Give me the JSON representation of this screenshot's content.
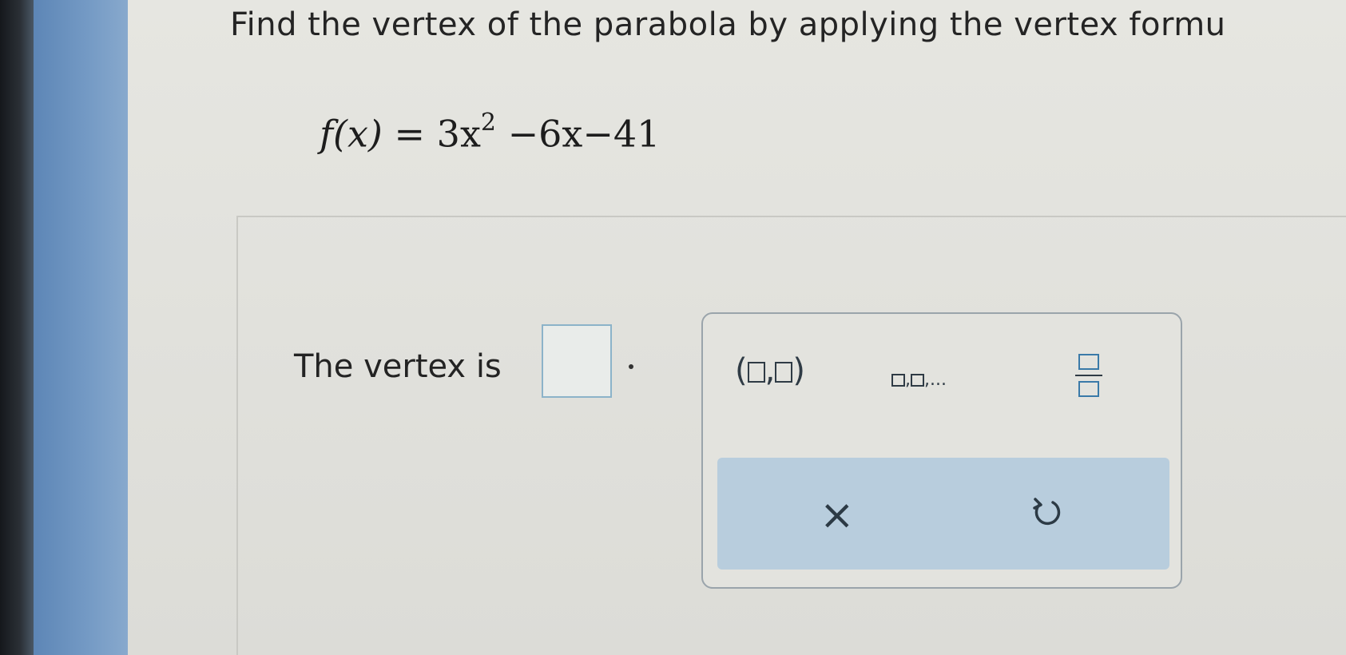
{
  "question": {
    "prompt": "Find the vertex of the parabola by applying the vertex formu",
    "equation_lhs": "f(x)",
    "equation_eq": "=",
    "equation_term1": "3x",
    "equation_exponent": "2",
    "equation_rest": "−6x−41"
  },
  "answer": {
    "label": "The vertex is",
    "value": "",
    "punctuation": "."
  },
  "keypad": {
    "ordered_pair": {
      "open": "(",
      "comma": ",",
      "close": ")"
    },
    "list": {
      "comma": ",",
      "ellipsis": ",..."
    },
    "actions": {
      "clear_symbol": "×",
      "undo_icon": "undo-icon"
    }
  },
  "colors": {
    "sidebar": "#7399c4",
    "answer_box_border": "#8cb3c9",
    "action_bar": "#b8cddd"
  }
}
